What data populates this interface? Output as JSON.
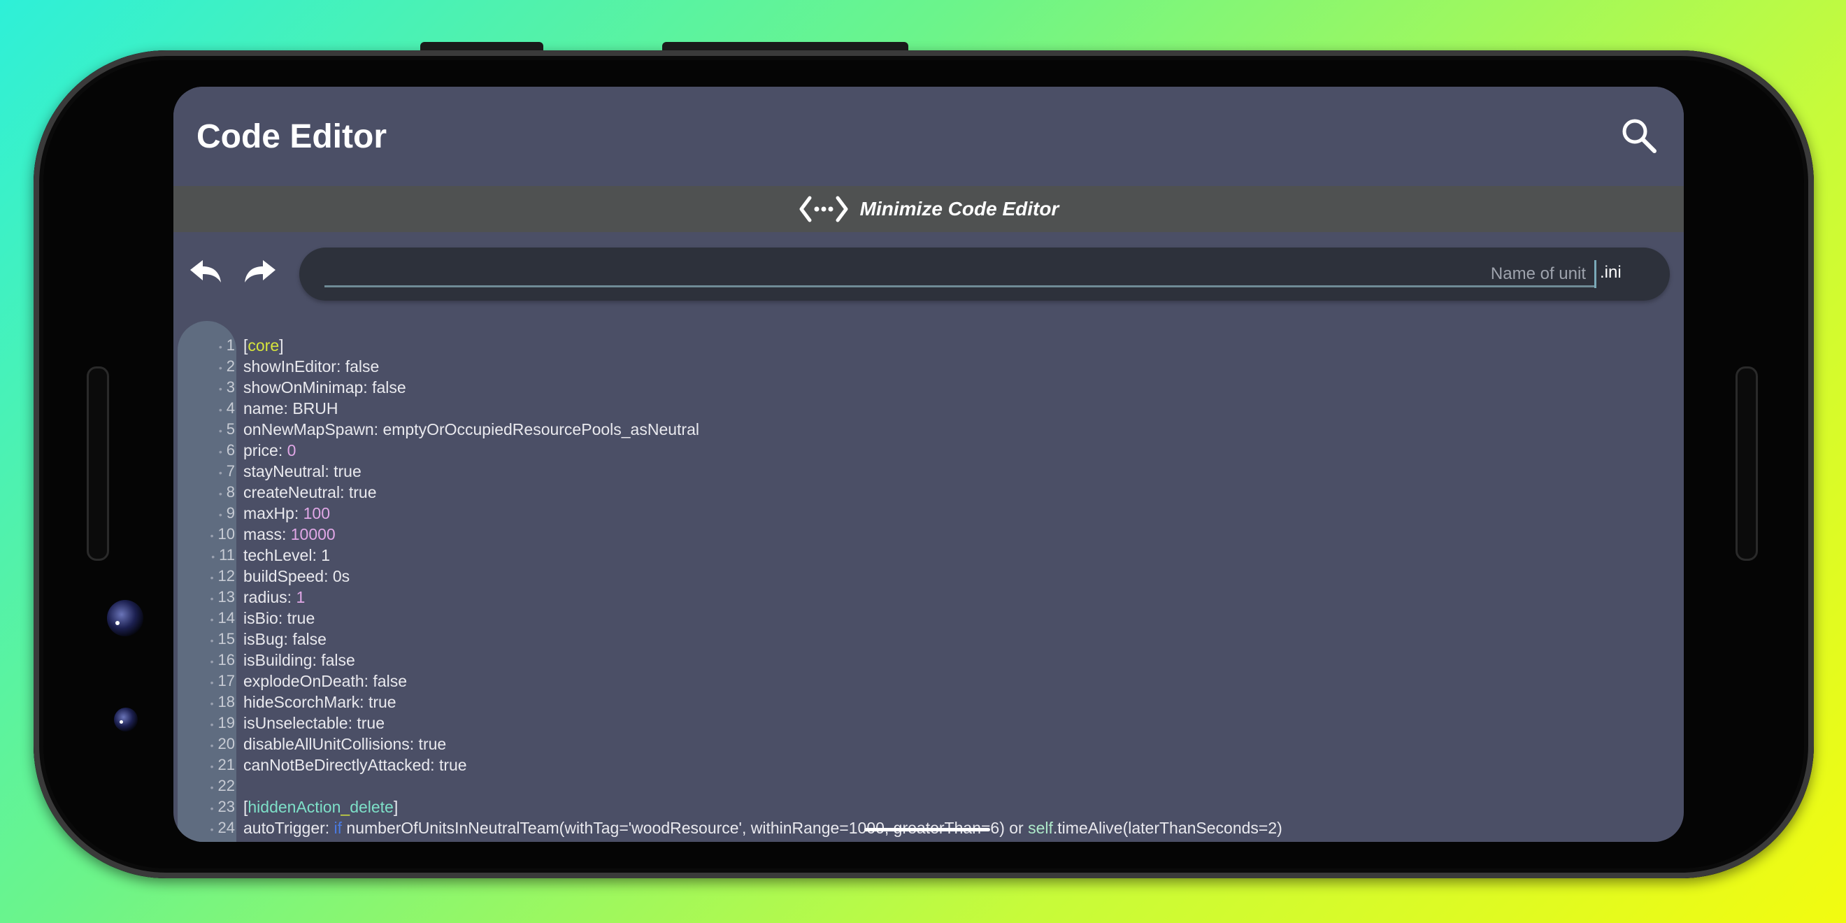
{
  "app": {
    "title": "Code Editor",
    "minimize_label": "Minimize Code Editor"
  },
  "toolbar": {
    "filename_placeholder": "Name of unit",
    "filename_value": "",
    "extension": ".ini"
  },
  "icons": {
    "search": "search-icon",
    "undo": "undo-icon",
    "redo": "redo-icon",
    "minimize": "code-brackets-icon"
  },
  "colors": {
    "background": "#4b4f66",
    "minimize_bar": "#4f5151",
    "gutter": "#5f6c80",
    "section_header": "#d6e43c",
    "number": "#e0a7e6"
  },
  "code": {
    "lines": [
      {
        "n": "1",
        "text": "[core]"
      },
      {
        "n": "2",
        "text": "showInEditor: false"
      },
      {
        "n": "3",
        "text": "showOnMinimap: false"
      },
      {
        "n": "4",
        "text": "name: BRUH"
      },
      {
        "n": "5",
        "text": "onNewMapSpawn: emptyOrOccupiedResourcePools_asNeutral"
      },
      {
        "n": "6",
        "text": "price: 0"
      },
      {
        "n": "7",
        "text": "stayNeutral: true"
      },
      {
        "n": "8",
        "text": "createNeutral: true"
      },
      {
        "n": "9",
        "text": "maxHp: 100"
      },
      {
        "n": "10",
        "text": "mass: 10000"
      },
      {
        "n": "11",
        "text": "techLevel: 1"
      },
      {
        "n": "12",
        "text": "buildSpeed: 0s"
      },
      {
        "n": "13",
        "text": "radius: 1"
      },
      {
        "n": "14",
        "text": "isBio: true"
      },
      {
        "n": "15",
        "text": "isBug: false"
      },
      {
        "n": "16",
        "text": "isBuilding: false"
      },
      {
        "n": "17",
        "text": "explodeOnDeath: false"
      },
      {
        "n": "18",
        "text": "hideScorchMark: true"
      },
      {
        "n": "19",
        "text": "isUnselectable: true"
      },
      {
        "n": "20",
        "text": "disableAllUnitCollisions: true"
      },
      {
        "n": "21",
        "text": "canNotBeDirectlyAttacked: true"
      },
      {
        "n": "22",
        "text": ""
      },
      {
        "n": "23",
        "text": "[hiddenAction_delete]"
      },
      {
        "n": "24",
        "text": "autoTrigger: if numberOfUnitsInNeutralTeam(withTag='woodResource', withinRange=1000, greaterThan=6) or self.timeAlive(laterThanSeconds=2)"
      }
    ]
  }
}
